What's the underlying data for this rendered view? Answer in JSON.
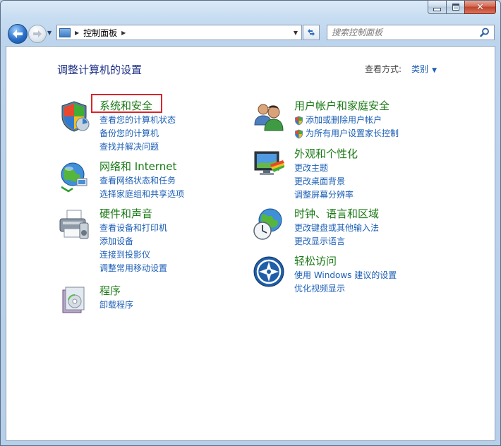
{
  "window": {
    "caption": {
      "min": "—",
      "max": "□",
      "close": "✕"
    }
  },
  "nav": {
    "address_path": "控制面板",
    "search_placeholder": "搜索控制面板"
  },
  "content": {
    "heading": "调整计算机的设置",
    "view_by_label": "查看方式:",
    "view_by_value": "类别"
  },
  "categories_left": [
    {
      "title": "系统和安全",
      "links": [
        "查看您的计算机状态",
        "备份您的计算机",
        "查找并解决问题"
      ]
    },
    {
      "title": "网络和 Internet",
      "links": [
        "查看网络状态和任务",
        "选择家庭组和共享选项"
      ]
    },
    {
      "title": "硬件和声音",
      "links": [
        "查看设备和打印机",
        "添加设备",
        "连接到投影仪",
        "调整常用移动设置"
      ]
    },
    {
      "title": "程序",
      "links": [
        "卸载程序"
      ]
    }
  ],
  "categories_right": [
    {
      "title": "用户帐户和家庭安全",
      "links": [
        "添加或删除用户帐户",
        "为所有用户设置家长控制"
      ]
    },
    {
      "title": "外观和个性化",
      "links": [
        "更改主题",
        "更改桌面背景",
        "调整屏幕分辨率"
      ]
    },
    {
      "title": "时钟、语言和区域",
      "links": [
        "更改键盘或其他输入法",
        "更改显示语言"
      ]
    },
    {
      "title": "轻松访问",
      "links": [
        "使用 Windows 建议的设置",
        "优化视频显示"
      ]
    }
  ],
  "colors": {
    "category_title": "#1b7a16",
    "link": "#1c5fb6",
    "heading": "#1e3287",
    "highlight_box": "#d9252a"
  }
}
